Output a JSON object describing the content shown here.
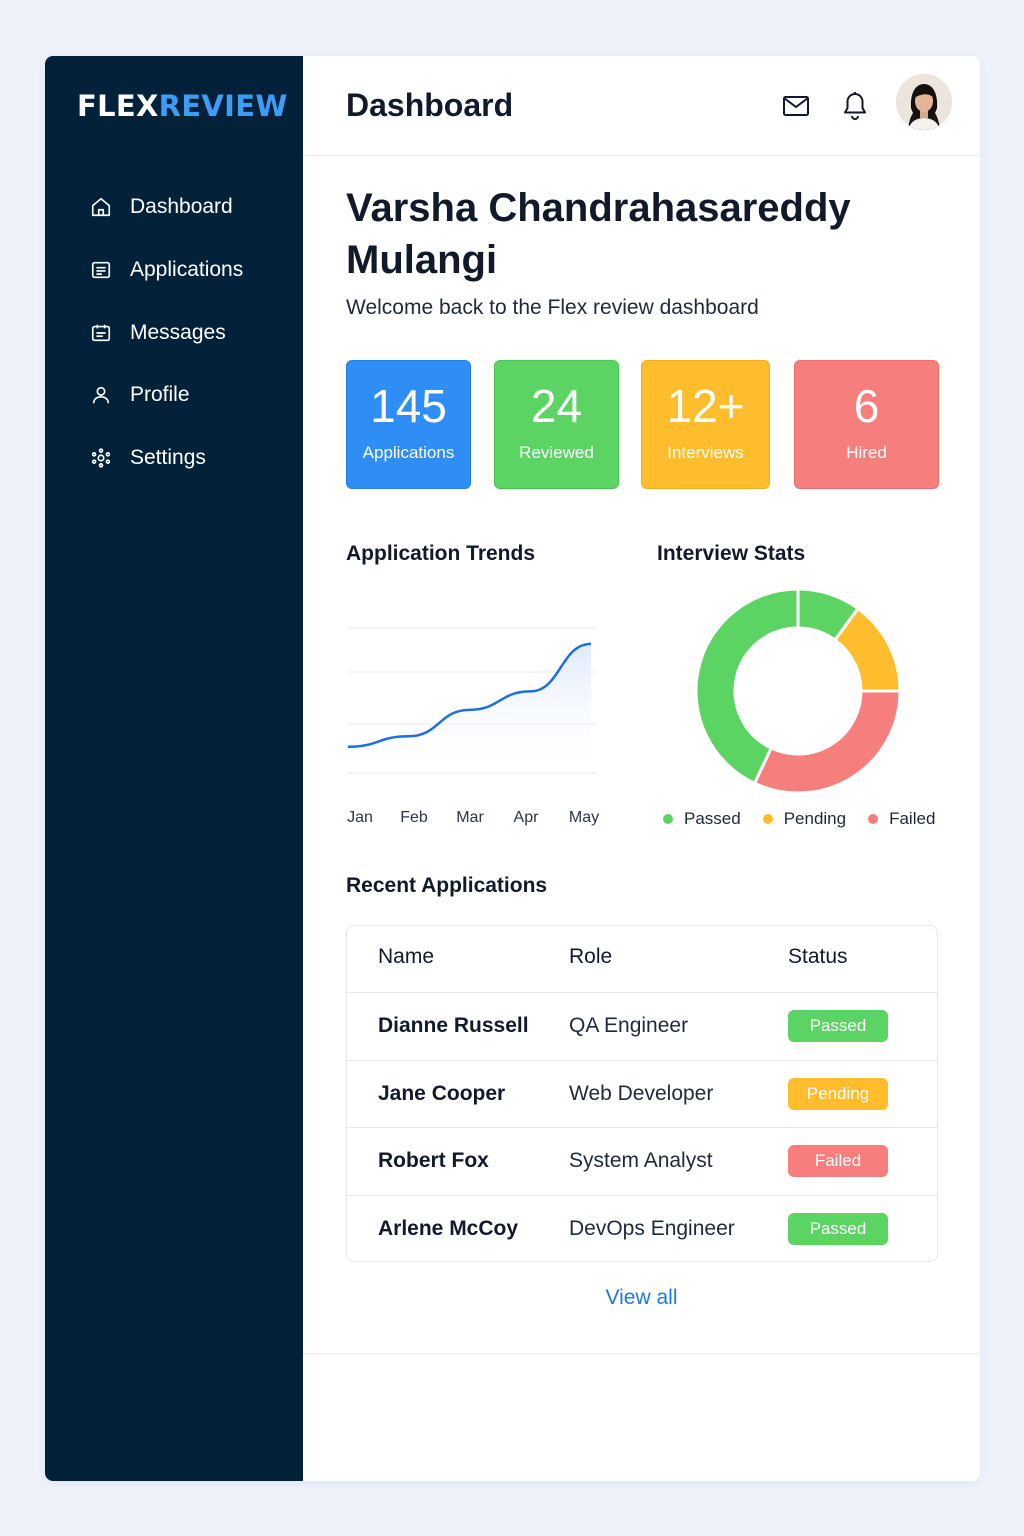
{
  "brand": {
    "part1": "FLEX",
    "part2": "REVIEW"
  },
  "sidebar": {
    "items": [
      {
        "label": "Dashboard",
        "icon": "home-icon"
      },
      {
        "label": "Applications",
        "icon": "list-icon"
      },
      {
        "label": "Messages",
        "icon": "message-icon"
      },
      {
        "label": "Profile",
        "icon": "user-icon"
      },
      {
        "label": "Settings",
        "icon": "gear-icon"
      }
    ]
  },
  "header": {
    "title": "Dashboard",
    "icons": [
      "mail-icon",
      "bell-icon"
    ]
  },
  "user": {
    "name": "Varsha Chandrahasareddy Mulangi",
    "welcome": "Welcome back to the Flex review dashboard"
  },
  "stats": [
    {
      "value": "145",
      "label": "Applications",
      "color": "#2e8ef5"
    },
    {
      "value": "24",
      "label": "Reviewed",
      "color": "#5cd463"
    },
    {
      "value": "12+",
      "label": "Interviews",
      "color": "#fdbd2c"
    },
    {
      "value": "6",
      "label": "Hired",
      "color": "#f67e7c"
    }
  ],
  "chart_data": [
    {
      "type": "area",
      "title": "Application Trends",
      "categories": [
        "Jan",
        "Feb",
        "Mar",
        "Apr",
        "May"
      ],
      "values": [
        10,
        18,
        38,
        52,
        88
      ],
      "grid": true,
      "color": "#1e6fe0"
    },
    {
      "type": "pie",
      "title": "Interview Stats",
      "labels": [
        "Passed",
        "Pending",
        "Failed"
      ],
      "values": [
        53,
        15,
        32
      ],
      "colors": [
        "#5cd463",
        "#fdbd2c",
        "#f67e7c"
      ],
      "legend": "bottom"
    }
  ],
  "recent": {
    "title": "Recent Applications",
    "columns": [
      "Name",
      "Role",
      "Status"
    ],
    "rows": [
      {
        "name": "Dianne Russell",
        "role": "QA Engineer",
        "status": "Passed"
      },
      {
        "name": "Jane Cooper",
        "role": "Web Developer",
        "status": "Pending"
      },
      {
        "name": "Robert Fox",
        "role": "System Analyst",
        "status": "Failed"
      },
      {
        "name": "Arlene McCoy",
        "role": "DevOps Engineer",
        "status": "Passed"
      }
    ],
    "view_all": "View all"
  },
  "status_colors": {
    "Passed": "#5cd463",
    "Pending": "#fdbd2c",
    "Failed": "#f67e7c"
  }
}
